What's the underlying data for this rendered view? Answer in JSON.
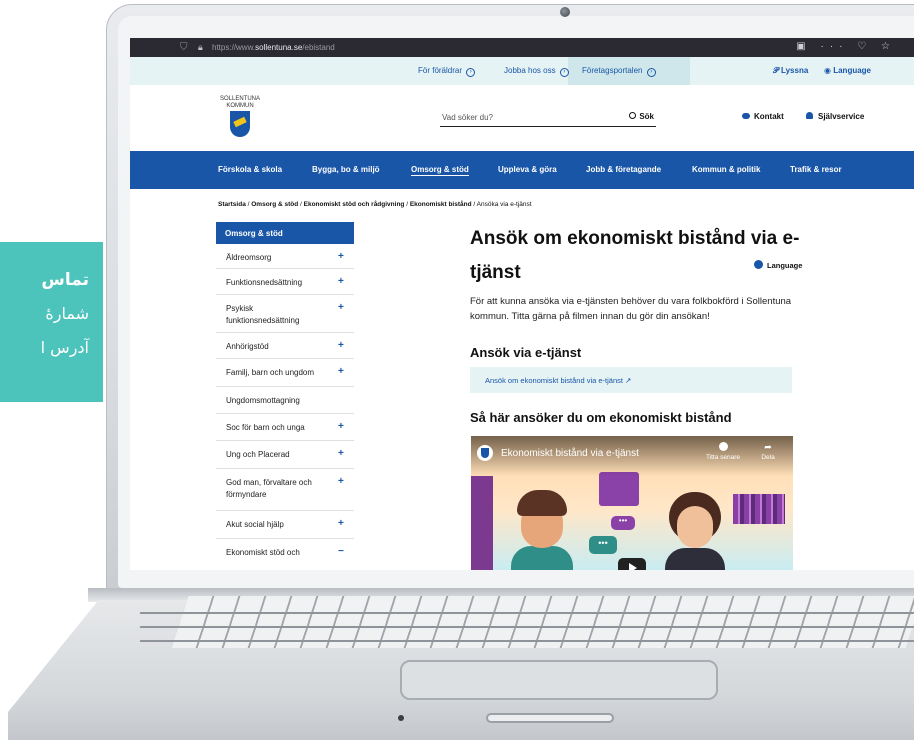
{
  "side_card": {
    "line1": "تماس",
    "line2": "شمارهٔ",
    "line3": "آدرس ا"
  },
  "browser": {
    "url_prefix": "https://www.",
    "url_domain": "sollentuna.se",
    "url_path": "/ebistand",
    "controls": "▣ ··· ♡ ☆"
  },
  "utility": {
    "links": [
      "För föräldrar",
      "Jobba hos oss",
      "Företagsportalen"
    ],
    "listen": "Lyssna",
    "language": "Language"
  },
  "header": {
    "logo_line1": "SOLLENTUNA",
    "logo_line2": "KOMMUN",
    "search_placeholder": "Vad söker du?",
    "search_button": "Sök",
    "contact": "Kontakt",
    "self_service": "Självservice"
  },
  "main_nav": [
    "Förskola & skola",
    "Bygga, bo & miljö",
    "Omsorg & stöd",
    "Uppleva & göra",
    "Jobb & företagande",
    "Kommun & politik",
    "Trafik & resor"
  ],
  "main_nav_active": "Omsorg & stöd",
  "breadcrumb": {
    "items": [
      "Startsida",
      "Omsorg & stöd",
      "Ekonomiskt stöd och rådgivning",
      "Ekonomiskt bistånd"
    ],
    "current": "Ansöka via e-tjänst",
    "separator": " / "
  },
  "side_nav": {
    "heading": "Omsorg & stöd",
    "items": [
      {
        "label": "Äldreomsorg",
        "toggle": "+"
      },
      {
        "label": "Funktionsnedsättning",
        "toggle": "+"
      },
      {
        "label": "Psykisk funktionsnedsättning",
        "toggle": "+"
      },
      {
        "label": "Anhörigstöd",
        "toggle": "+"
      },
      {
        "label": "Familj, barn och ungdom",
        "toggle": "+"
      },
      {
        "label": "Ungdomsmottagning",
        "toggle": ""
      },
      {
        "label": "Soc för barn och unga",
        "toggle": "+"
      },
      {
        "label": "Ung och Placerad",
        "toggle": "+"
      },
      {
        "label": "God man, förvaltare och förmyndare",
        "toggle": "+"
      },
      {
        "label": "Akut social hjälp",
        "toggle": "+"
      },
      {
        "label": "Ekonomiskt stöd och",
        "toggle": "−"
      }
    ]
  },
  "content": {
    "title": "Ansök om ekonomiskt bistånd via e-tjänst",
    "language": "Language",
    "intro": "För att kunna ansöka via e-tjänsten behöver du vara folkbokförd i Sollentuna kommun. Titta gärna på filmen innan du gör din ansökan!",
    "section1": "Ansök via e-tjänst",
    "eservice_link": "Ansök om ekonomiskt bistånd via e-tjänst",
    "section2": "Så här ansöker du om ekonomiskt bistånd"
  },
  "video": {
    "title": "Ekonomiskt bistånd via e-tjänst",
    "watch_later": "Titta senare",
    "share": "Dela",
    "bubble1": "•••",
    "bubble2": "•••"
  },
  "colors": {
    "brand_blue": "#1a56a8",
    "util_bg": "#e5f3f5",
    "side_card": "#4cc3bb"
  }
}
